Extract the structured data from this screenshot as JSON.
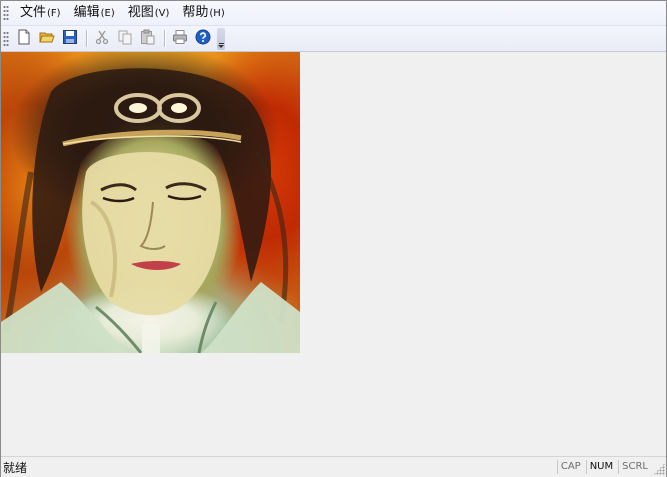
{
  "menubar": {
    "items": [
      {
        "label": "文件",
        "accel": "(F)"
      },
      {
        "label": "编辑",
        "accel": "(E)"
      },
      {
        "label": "视图",
        "accel": "(V)"
      },
      {
        "label": "帮助",
        "accel": "(H)"
      }
    ]
  },
  "toolbar": {
    "buttons": [
      "new-file-icon",
      "open-folder-icon",
      "save-icon",
      "cut-icon",
      "copy-icon",
      "paste-icon",
      "print-icon",
      "help-icon"
    ]
  },
  "statusbar": {
    "text": "就绪",
    "indicators": [
      "CAP",
      "NUM",
      "SCRL"
    ]
  },
  "colors": {
    "menubar_bg": "#eef0fb",
    "client_bg": "#f0f0f0",
    "help_blue": "#1f5fc8"
  }
}
